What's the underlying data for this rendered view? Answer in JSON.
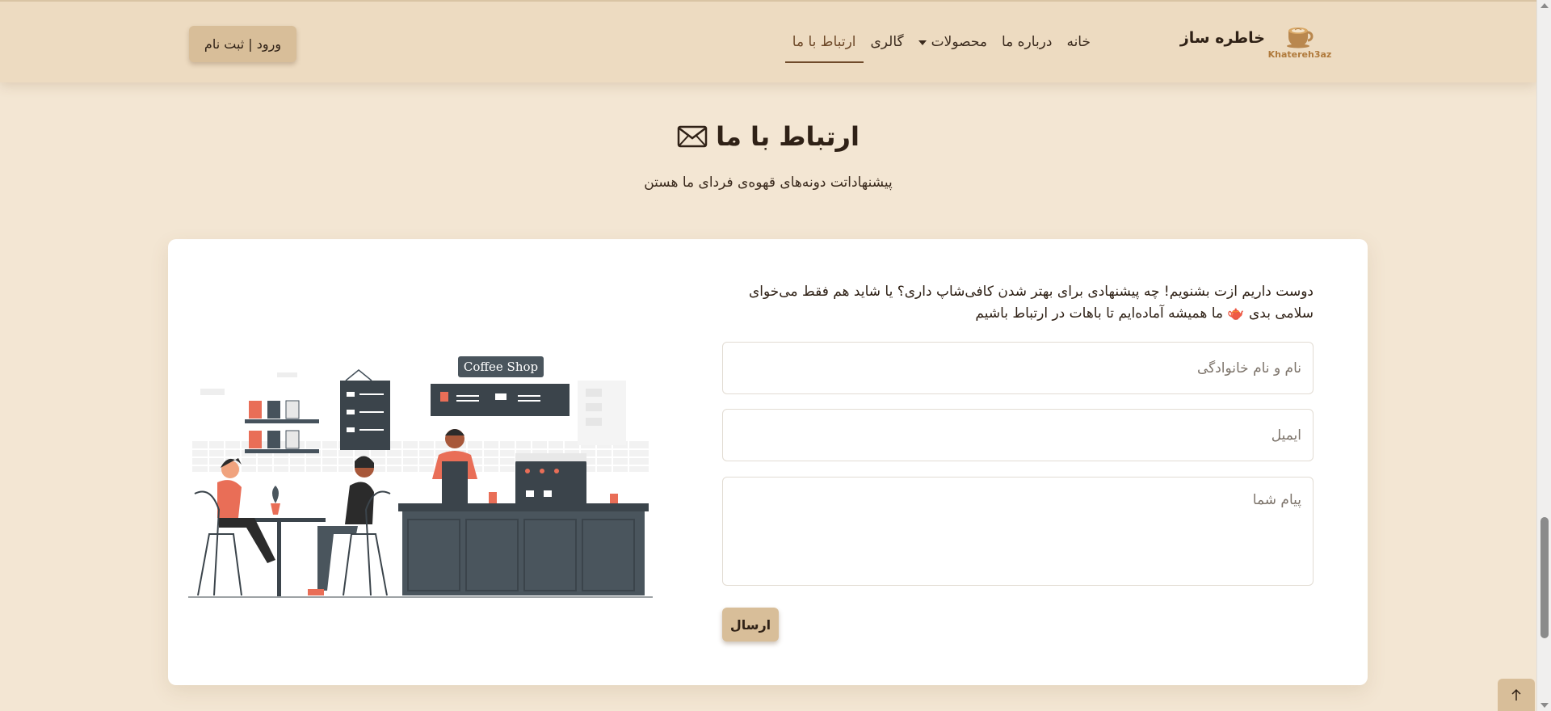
{
  "brand": {
    "name": "خاطره ساز",
    "logo_text": "Khatereh3az",
    "logo_icon": "coffee-cup-icon"
  },
  "nav": {
    "items": [
      {
        "label": "خانه"
      },
      {
        "label": "درباره ما"
      },
      {
        "label": "محصولات",
        "dropdown": true
      },
      {
        "label": "گالری"
      },
      {
        "label": "ارتباط با ما",
        "active": true
      }
    ]
  },
  "auth": {
    "label": "ورود | ثبت نام"
  },
  "header": {
    "title": "ارتباط با ما",
    "title_icon": "envelope-icon",
    "subtitle": "پیشنهاداتت دونه‌های قهوه‌ی فردای ما هستن"
  },
  "form": {
    "intro_line1": "دوست داریم ازت بشنویم! چه پیشنهادی برای بهتر شدن کافی‌شاپ داری؟ یا شاید هم فقط می‌خوای",
    "intro_line2": "سلامی بدی 🫖 ما همیشه آماده‌ایم تا باهات در ارتباط باشیم",
    "name_placeholder": "نام و نام خانوادگی",
    "email_placeholder": "ایمیل",
    "message_placeholder": "پیام شما",
    "submit_label": "ارسال"
  },
  "illustration": {
    "sign_text": "Coffee Shop"
  },
  "colors": {
    "accent": "#d8be99",
    "navbar_bg": "#eddbc1",
    "page_bg": "#f3e6d3",
    "active_nav": "#6f4a2a"
  },
  "back_to_top_icon": "arrow-up-icon"
}
